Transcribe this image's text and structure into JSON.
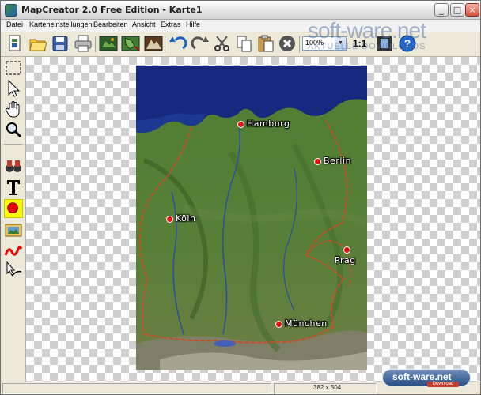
{
  "window": {
    "title": "MapCreator 2.0 Free Edition - Karte1",
    "controls": [
      "_",
      "□",
      "×"
    ]
  },
  "menu": [
    "Datei",
    "Karteneinstellungen",
    "Bearbeiten",
    "Ansicht",
    "Extras",
    "Hilfe"
  ],
  "toolbar": {
    "zoom_value": "100%",
    "one_to_one": "1:1",
    "icons": [
      "new-document-icon",
      "open-folder-icon",
      "save-icon",
      "print-icon",
      "map-export-icon",
      "map-region-icon",
      "map-pattern-icon",
      "undo-icon",
      "redo-icon",
      "cut-icon",
      "copy-icon",
      "paste-icon",
      "delete-icon",
      "film-icon",
      "help-icon"
    ]
  },
  "tools": [
    "select-rectangle-icon",
    "pointer-icon",
    "hand-icon",
    "magnifier-icon",
    "binoculars-icon",
    "text-icon",
    "city-marker-icon",
    "image-icon",
    "line-icon",
    "route-icon"
  ],
  "watermark": {
    "brand": "soft-ware.net",
    "tagline": "AKTUELLE DOWNLOADS",
    "badge_brand": "soft-ware.net",
    "badge_download": "Download"
  },
  "map": {
    "cities": [
      {
        "name": "Hamburg"
      },
      {
        "name": "Berlin"
      },
      {
        "name": "Köln"
      },
      {
        "name": "Prag"
      },
      {
        "name": "München"
      }
    ]
  },
  "status": {
    "size": "382 x 504"
  },
  "colors": {
    "city_dot": "#e21010",
    "water": "#1a2f8c",
    "land": "#4e7b32",
    "border": "#c4502a"
  }
}
